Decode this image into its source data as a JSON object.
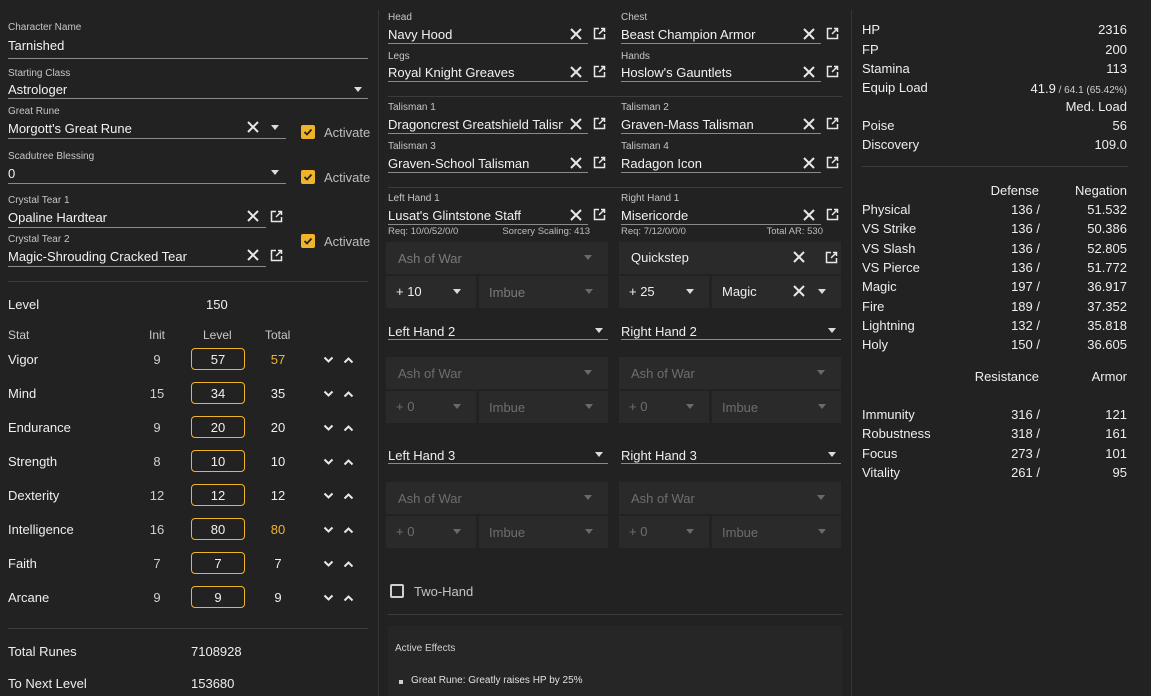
{
  "character": {
    "name_label": "Character Name",
    "name": "Tarnished",
    "class_label": "Starting Class",
    "class": "Astrologer",
    "great_rune_label": "Great Rune",
    "great_rune": "Morgott's Great Rune",
    "scadutree_label": "Scadutree Blessing",
    "scadutree": "0",
    "tear1_label": "Crystal Tear 1",
    "tear1": "Opaline Hardtear",
    "tear2_label": "Crystal Tear 2",
    "tear2": "Magic-Shrouding Cracked Tear",
    "activate_label": "Activate"
  },
  "level": {
    "label": "Level",
    "value": "150",
    "col_stat": "Stat",
    "col_init": "Init",
    "col_level": "Level",
    "col_total": "Total",
    "stats": [
      {
        "name": "Vigor",
        "init": "9",
        "level": "57",
        "total": "57",
        "hl": true
      },
      {
        "name": "Mind",
        "init": "15",
        "level": "34",
        "total": "35",
        "hl": false
      },
      {
        "name": "Endurance",
        "init": "9",
        "level": "20",
        "total": "20",
        "hl": false
      },
      {
        "name": "Strength",
        "init": "8",
        "level": "10",
        "total": "10",
        "hl": false
      },
      {
        "name": "Dexterity",
        "init": "12",
        "level": "12",
        "total": "12",
        "hl": false
      },
      {
        "name": "Intelligence",
        "init": "16",
        "level": "80",
        "total": "80",
        "hl": true
      },
      {
        "name": "Faith",
        "init": "7",
        "level": "7",
        "total": "7",
        "hl": false
      },
      {
        "name": "Arcane",
        "init": "9",
        "level": "9",
        "total": "9",
        "hl": false
      }
    ],
    "total_runes_label": "Total Runes",
    "total_runes": "7108928",
    "next_level_label": "To Next Level",
    "next_level": "153680"
  },
  "armor": {
    "head_label": "Head",
    "head": "Navy Hood",
    "chest_label": "Chest",
    "chest": "Beast Champion Armor",
    "legs_label": "Legs",
    "legs": "Royal Knight Greaves",
    "hands_label": "Hands",
    "hands": "Hoslow's Gauntlets"
  },
  "talismans": {
    "t1_label": "Talisman 1",
    "t1": "Dragoncrest Greatshield Talisman",
    "t2_label": "Talisman 2",
    "t2": "Graven-Mass Talisman",
    "t3_label": "Talisman 3",
    "t3": "Graven-School Talisman",
    "t4_label": "Talisman 4",
    "t4": "Radagon Icon"
  },
  "weapons": {
    "lh1_label": "Left Hand 1",
    "lh1": "Lusat's Glintstone Staff",
    "lh1_req": "Req: 10/0/52/0/0",
    "lh1_scaling": "Sorcery Scaling: 413",
    "rh1_label": "Right Hand 1",
    "rh1": "Misericorde",
    "rh1_req": "Req: 7/12/0/0/0",
    "rh1_ar": "Total AR: 530",
    "ash_placeholder": "Ash of War",
    "imbue_placeholder": "Imbue",
    "lh1_upgrade": "+ 10",
    "rh1_ash": "Quickstep",
    "rh1_upgrade": "+ 25",
    "rh1_imbue": "Magic",
    "lh2": "Left Hand 2",
    "rh2": "Right Hand 2",
    "lh3": "Left Hand 3",
    "rh3": "Right Hand 3",
    "upgrade_zero": "+ 0",
    "two_hand_label": "Two-Hand",
    "effects_title": "Active Effects",
    "effect1": "Great Rune: Greatly raises HP by 25%"
  },
  "stats": {
    "hp_label": "HP",
    "hp": "2316",
    "fp_label": "FP",
    "fp": "200",
    "stamina_label": "Stamina",
    "stamina": "113",
    "equip_label": "Equip Load",
    "equip_main": "41.9",
    "equip_sub": " / 64.1 (65.42%)",
    "equip_class": "Med. Load",
    "poise_label": "Poise",
    "poise": "56",
    "discovery_label": "Discovery",
    "discovery": "109.0",
    "defense_header": "Defense",
    "negation_header": "Negation",
    "defense": [
      {
        "name": "Physical",
        "def": "136 /",
        "neg": "51.532"
      },
      {
        "name": "VS Strike",
        "def": "136 /",
        "neg": "50.386"
      },
      {
        "name": "VS Slash",
        "def": "136 /",
        "neg": "52.805"
      },
      {
        "name": "VS Pierce",
        "def": "136 /",
        "neg": "51.772"
      },
      {
        "name": "Magic",
        "def": "197 /",
        "neg": "36.917"
      },
      {
        "name": "Fire",
        "def": "189 /",
        "neg": "37.352"
      },
      {
        "name": "Lightning",
        "def": "132 /",
        "neg": "35.818"
      },
      {
        "name": "Holy",
        "def": "150 /",
        "neg": "36.605"
      }
    ],
    "resistance_header": "Resistance",
    "armor_header": "Armor",
    "resist": [
      {
        "name": "Immunity",
        "res": "316 /",
        "arm": "121"
      },
      {
        "name": "Robustness",
        "res": "318 /",
        "arm": "161"
      },
      {
        "name": "Focus",
        "res": "273 /",
        "arm": "101"
      },
      {
        "name": "Vitality",
        "res": "261 /",
        "arm": "95"
      }
    ]
  },
  "icons": {
    "clear": "close-icon",
    "open": "open-in-new-icon",
    "dropdown": "chevron-down-icon",
    "check": "check-icon",
    "up": "chevron-up-icon",
    "down": "chevron-down-icon"
  },
  "colors": {
    "accent": "#f0b429",
    "background": "#222222"
  }
}
